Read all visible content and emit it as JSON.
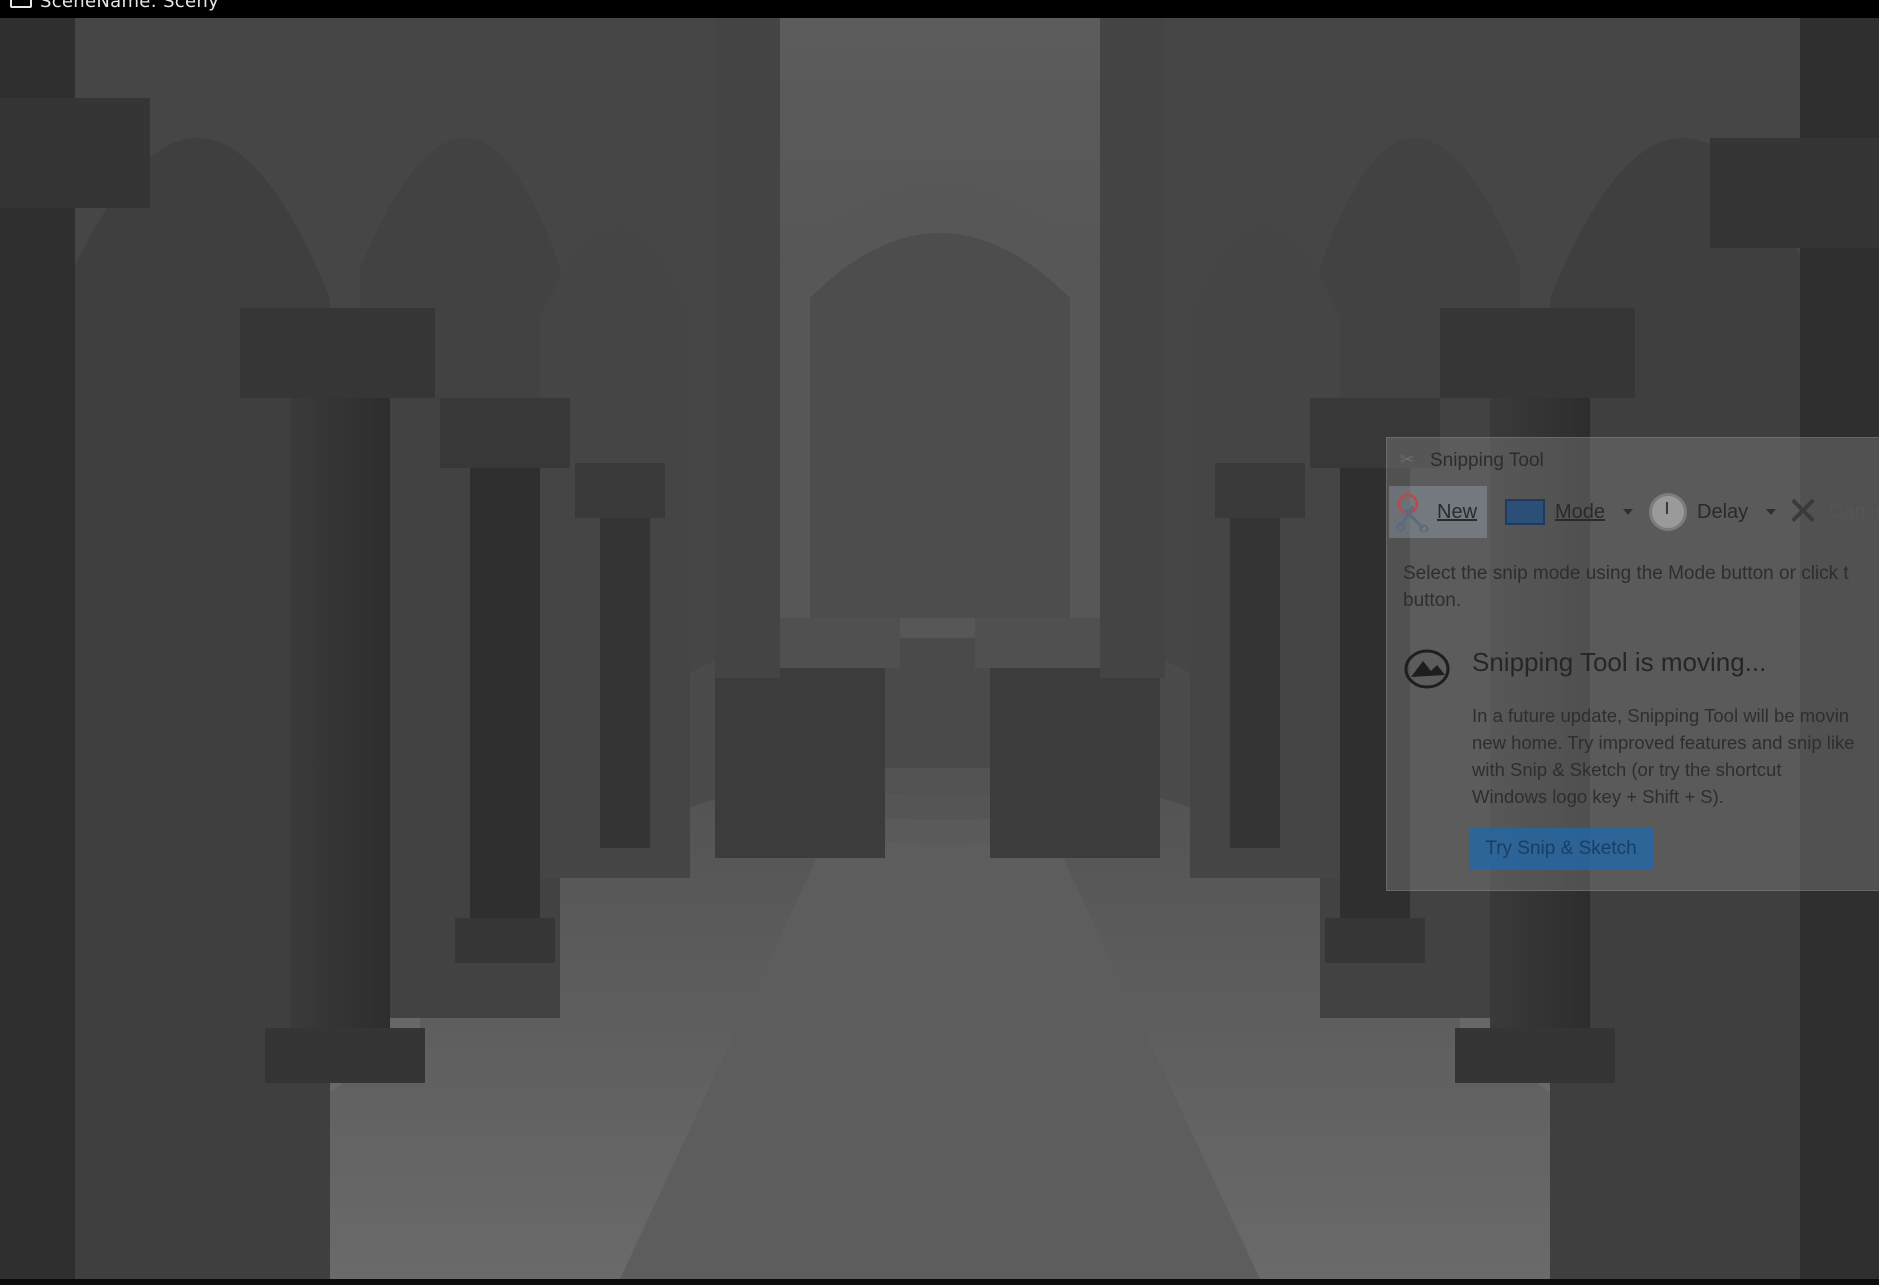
{
  "app": {
    "title": "SceneName: Sceny",
    "icon": "window-icon"
  },
  "viewport": {
    "description_icon": "render-viewport"
  },
  "snipping_tool": {
    "title": "Snipping Tool",
    "toolbar": {
      "new_label": "New",
      "mode_label": "Mode",
      "delay_label": "Delay",
      "cancel_label": "Cance"
    },
    "hint_line1": "Select the snip mode using the Mode button or click t",
    "hint_line2": "button.",
    "notice": {
      "heading": "Snipping Tool is moving...",
      "body_line1": "In a future update, Snipping Tool will be movin",
      "body_line2": "new home. Try improved features and snip like",
      "body_line3": "with Snip & Sketch (or try the shortcut",
      "body_line4": "Windows logo key + Shift + S)."
    },
    "try_button_label": "Try Snip & Sketch"
  }
}
